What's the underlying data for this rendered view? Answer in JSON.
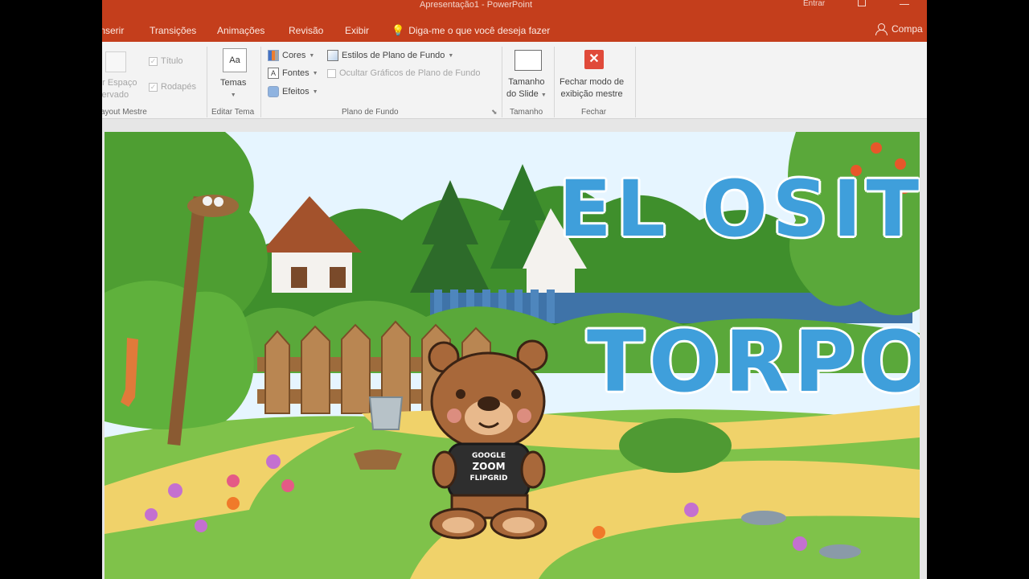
{
  "window": {
    "title": "Apresentação1  -  PowerPoint",
    "signin": "Entrar"
  },
  "tabs": [
    {
      "label": "Inserir"
    },
    {
      "label": "Transições"
    },
    {
      "label": "Animações"
    },
    {
      "label": "Revisão"
    },
    {
      "label": "Exibir"
    }
  ],
  "tell_me": "Diga-me o que você deseja fazer",
  "share_label": "Compa",
  "ribbon": {
    "layout_group": {
      "placeholder_btn": "rir Espaço",
      "placeholder_btn2": "servado",
      "title_chk": "Título",
      "footer_chk": "Rodapés",
      "label": "ayout Mestre"
    },
    "theme_group": {
      "themes_btn": "Temas",
      "label": "Editar Tema"
    },
    "background_group": {
      "colors": "Cores",
      "fonts": "Fontes",
      "effects": "Efeitos",
      "bg_styles": "Estilos de Plano de Fundo",
      "hide_graphics": "Ocultar Gráficos de Plano de Fundo",
      "label": "Plano de Fundo"
    },
    "size_group": {
      "slide_size_1": "Tamanho",
      "slide_size_2": "do Slide",
      "label": "Tamanho"
    },
    "close_group": {
      "close_1": "Fechar modo de",
      "close_2": "exibição mestre",
      "label": "Fechar"
    }
  },
  "slide": {
    "title_line1": "EL OSITO",
    "title_line2": "TORPON",
    "shirt_line1": "GOOGLE",
    "shirt_line2": "ZOOM",
    "shirt_line3": "FLIPGRID"
  },
  "colors": {
    "accent": "#c43e1c",
    "title_text": "#3f9fdb",
    "close_icon": "#e04a3a"
  }
}
